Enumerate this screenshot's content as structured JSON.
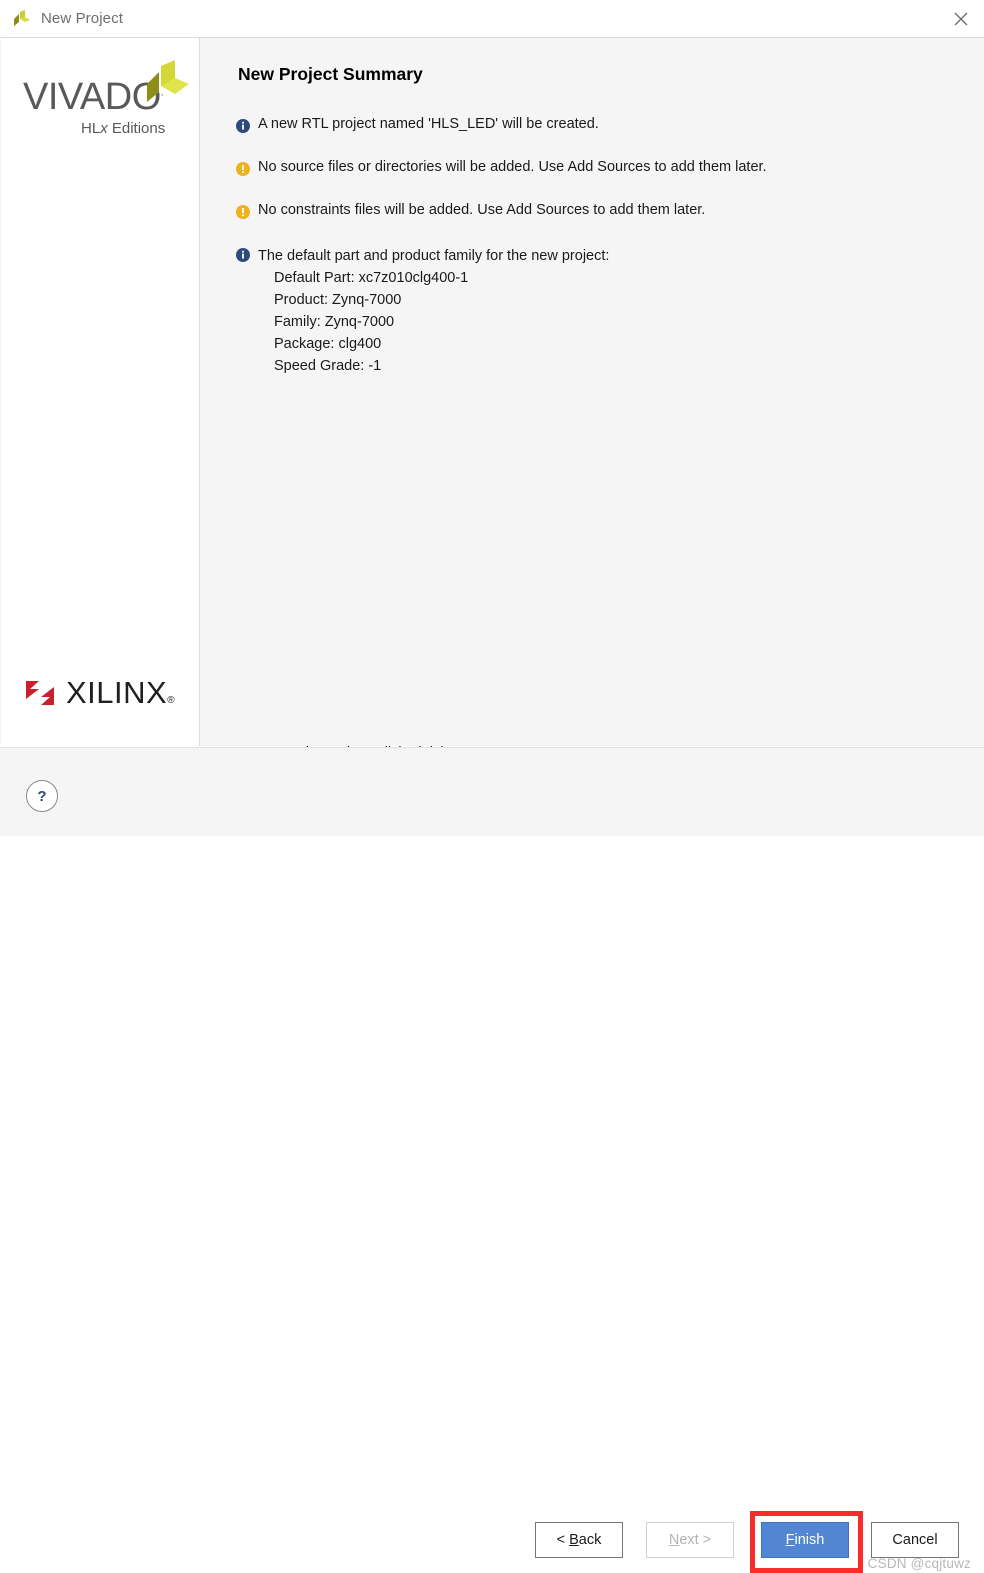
{
  "window": {
    "title": "New Project",
    "app_icon": "vivado-logo-icon",
    "close_icon": "close-icon"
  },
  "sidebar": {
    "product_name": "VIVADO",
    "product_registered_mark": ".",
    "product_edition_prefix": "HL",
    "product_edition_italic": "x",
    "product_edition_suffix": " Editions",
    "vendor_name": "XILINX",
    "vendor_registered_mark": "®",
    "logo_colors": {
      "vivado_olive": "#9c9c1e",
      "vivado_yellow": "#d8dd3a",
      "vivado_text": "#58595b",
      "xilinx_red": "#cc1f2e",
      "xilinx_dark": "#231f20"
    }
  },
  "main": {
    "page_title": "New Project Summary",
    "messages": [
      {
        "severity": "info",
        "icon": "info-icon",
        "text": "A new RTL project named 'HLS_LED' will be created."
      },
      {
        "severity": "warning",
        "icon": "warning-icon",
        "text": "No source files or directories will be added. Use Add Sources to add them later."
      },
      {
        "severity": "warning",
        "icon": "warning-icon",
        "text": "No constraints files will be added. Use Add Sources to add them later."
      },
      {
        "severity": "info",
        "icon": "info-icon",
        "text": "The default part and product family for the new project:",
        "details": [
          "Default Part: xc7z010clg400-1",
          "Product: Zynq-7000",
          "Family: Zynq-7000",
          "Package: clg400",
          "Speed Grade: -1"
        ]
      }
    ],
    "footer_note": "To create the project, click Finish"
  },
  "footer": {
    "help_label": "?",
    "buttons": [
      {
        "id": "back",
        "prefix": "< ",
        "mnemonic": "B",
        "suffix": "ack",
        "enabled": true,
        "primary": false
      },
      {
        "id": "next",
        "prefix": "",
        "mnemonic": "N",
        "suffix": "ext >",
        "enabled": false,
        "primary": false
      },
      {
        "id": "finish",
        "prefix": "",
        "mnemonic": "F",
        "suffix": "inish",
        "enabled": true,
        "primary": true
      },
      {
        "id": "cancel",
        "prefix": "Cancel",
        "mnemonic": "",
        "suffix": "",
        "enabled": true,
        "primary": false
      }
    ],
    "highlight": {
      "target": "finish",
      "color": "#fa2b2b"
    },
    "watermark": "CSDN @cqjtuwz"
  },
  "colors": {
    "info_icon": "#2e4a7d",
    "warning_icon": "#edb21f",
    "finish_button": "#5286d2",
    "panel_background": "#f5f5f5",
    "sidebar_background": "#ffffff"
  }
}
